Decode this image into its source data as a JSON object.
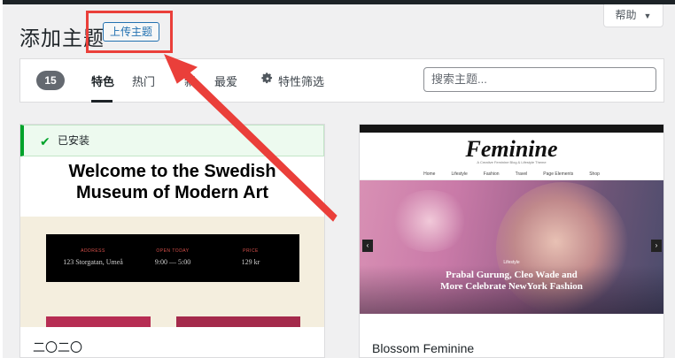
{
  "header": {
    "title": "添加主题",
    "upload_button": "上传主题",
    "help_button": "帮助"
  },
  "filter": {
    "count": "15",
    "tabs": [
      {
        "label": "特色",
        "active": true
      },
      {
        "label": "热门"
      },
      {
        "label": "新"
      },
      {
        "label": "最爱"
      },
      {
        "label": "特性筛选"
      }
    ],
    "search_placeholder": "搜索主题..."
  },
  "themes": [
    {
      "name": "二〇二〇",
      "installed_label": "已安装",
      "preview_title_line1": "Welcome to the Swedish",
      "preview_title_line2": "Museum of Modern Art",
      "info": [
        {
          "label": "ADDRESS",
          "value": "123 Storgatan, Umeå"
        },
        {
          "label": "OPEN TODAY",
          "value": "9:00 — 5:00"
        },
        {
          "label": "PRICE",
          "value": "129 kr"
        }
      ]
    },
    {
      "name": "Blossom Feminine",
      "preview_logo": "Feminine",
      "preview_tagline": "A Creative Feminine Blog & Lifestyle Theme",
      "preview_nav": [
        "Home",
        "Lifestyle",
        "Fashion",
        "Travel",
        "Page Elements",
        "Shop"
      ],
      "preview_category": "Lifestyle",
      "preview_headline_line1": "Prabal Gurung, Cleo Wade and",
      "preview_headline_line2": "More Celebrate NewYork Fashion"
    }
  ],
  "annotation_color": "#ea3f3a"
}
